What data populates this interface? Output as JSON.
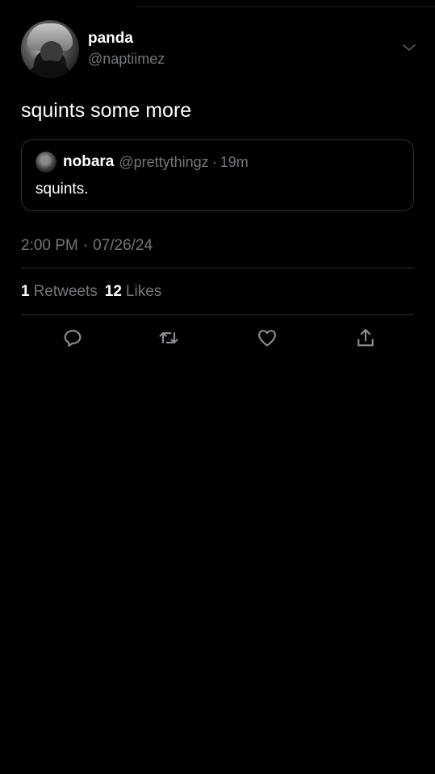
{
  "author": {
    "display_name": "panda",
    "handle": "@naptiimez"
  },
  "tweet": {
    "text": "squints some more"
  },
  "quoted_tweet": {
    "display_name": "nobara",
    "handle": "@prettythingz",
    "separator": "·",
    "time_ago": "19m",
    "text": "squints."
  },
  "meta": {
    "time": "2:00 PM",
    "separator": "·",
    "date": "07/26/24"
  },
  "stats": {
    "retweets_count": "1",
    "retweets_label": "Retweets",
    "likes_count": "12",
    "likes_label": "Likes"
  },
  "icons": {
    "reply": "reply-icon",
    "retweet": "retweet-icon",
    "like": "heart-icon",
    "share": "share-icon",
    "menu": "chevron-down-icon"
  },
  "colors": {
    "background": "#000000",
    "primary_text": "#ffffff",
    "secondary_text": "#71767b",
    "border": "#2f3336"
  }
}
